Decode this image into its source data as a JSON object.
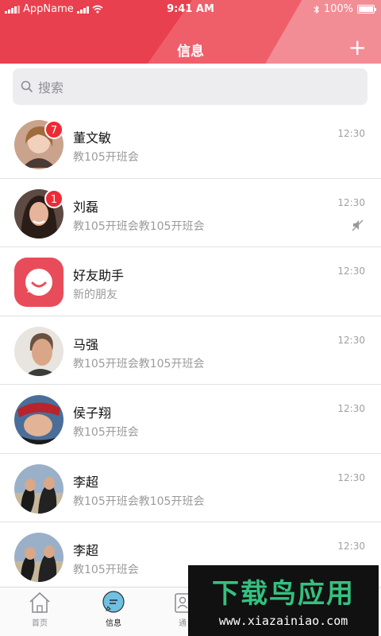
{
  "status_bar": {
    "carrier": "AppName",
    "time": "9:41 AM",
    "battery": "100%"
  },
  "header": {
    "title": "信息",
    "add_label": "+"
  },
  "search": {
    "placeholder": "搜索"
  },
  "conversations": [
    {
      "name": "董文敏",
      "message": "教105开班会",
      "time": "12:30",
      "badge": "7",
      "muted": false
    },
    {
      "name": "刘磊",
      "message": "教105开班会教105开班会",
      "time": "12:30",
      "badge": "1",
      "muted": true
    },
    {
      "name": "好友助手",
      "message": "新的朋友",
      "time": "12:30",
      "badge": "",
      "muted": false
    },
    {
      "name": "马强",
      "message": "教105开班会教105开班会",
      "time": "12:30",
      "badge": "",
      "muted": false
    },
    {
      "name": "侯子翔",
      "message": "教105开班会",
      "time": "12:30",
      "badge": "",
      "muted": false
    },
    {
      "name": "李超",
      "message": "教105开班会教105开班会",
      "time": "12:30",
      "badge": "",
      "muted": false
    },
    {
      "name": "李超",
      "message": "教105开班会",
      "time": "12:30",
      "badge": "",
      "muted": false
    }
  ],
  "tabbar": {
    "home": "首页",
    "messages": "信息",
    "contacts": "通"
  },
  "watermark": {
    "big": "下载鸟应用",
    "small": "www.xiazainiao.com"
  },
  "colors": {
    "brand": "#e8404e",
    "badge": "#ee2b34"
  }
}
